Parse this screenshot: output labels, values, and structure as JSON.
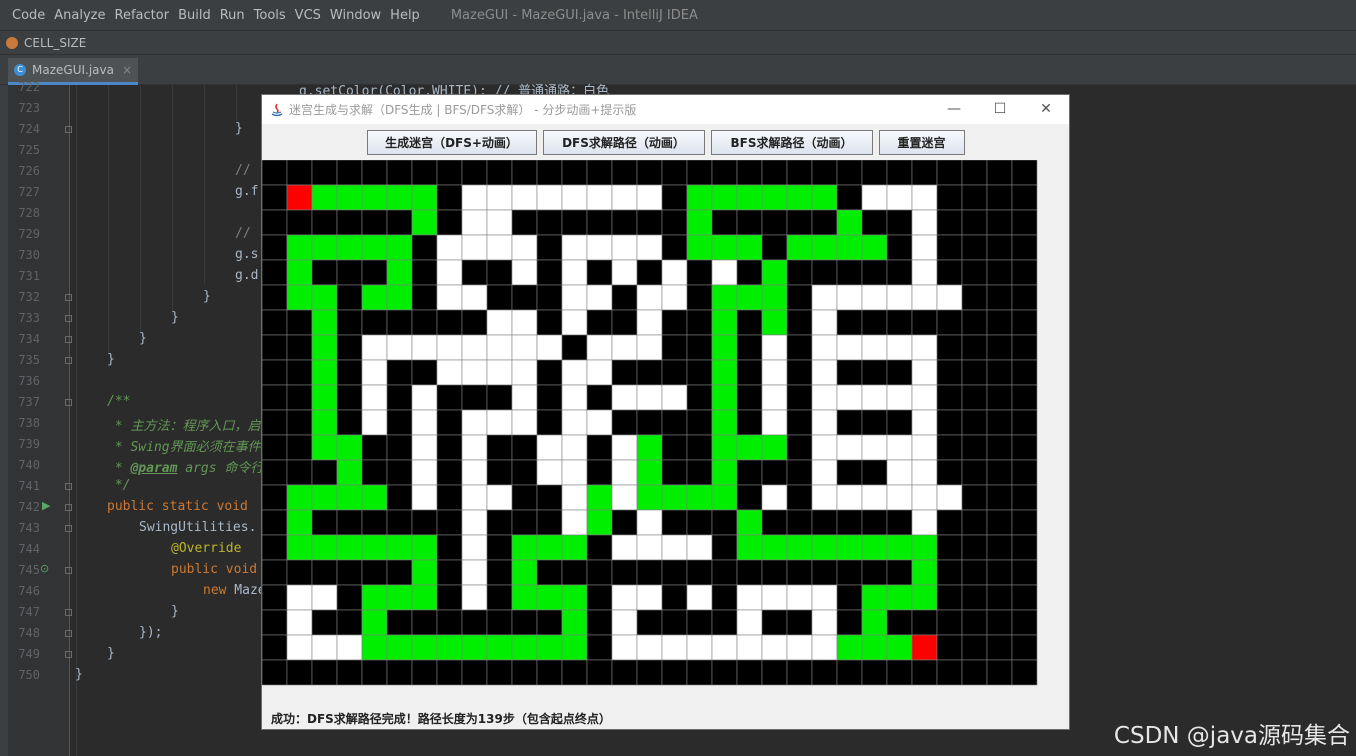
{
  "ide": {
    "menu": [
      "Code",
      "Analyze",
      "Refactor",
      "Build",
      "Run",
      "Tools",
      "VCS",
      "Window",
      "Help"
    ],
    "title": "MazeGUI - MazeGUI.java - IntelliJ IDEA",
    "breadcrumb": "CELL_SIZE",
    "tab": {
      "label": "MazeGUI.java",
      "close": "×"
    },
    "line_numbers": [
      "722",
      "723",
      "724",
      "725",
      "726",
      "727",
      "728",
      "729",
      "730",
      "731",
      "732",
      "733",
      "734",
      "735",
      "736",
      "737",
      "738",
      "739",
      "740",
      "741",
      "742",
      "743",
      "744",
      "745",
      "746",
      "747",
      "748",
      "749",
      "750"
    ],
    "code": {
      "l722": "g.setColor(Color.WHITE); // 普通通路：白色",
      "l724": "}",
      "l726": "// ",
      "l727": "g.f",
      "l729": "// ",
      "l730": "g.s",
      "l731": "g.d",
      "l732": "}",
      "l733": "}",
      "l734": "}",
      "l735": "}",
      "l737": "/**",
      "l738": " * 主方法：程序入口，启",
      "l739": " * Swing界面必须在事件",
      "l740_tag": "@param",
      "l740_rest": " args 命令行",
      "l740_star": " * ",
      "l741": " */",
      "l742_kw": "public static void",
      "l743": "SwingUtilities.",
      "l744": "@Override",
      "l745_kw": "public void",
      "l746_kw": "new",
      "l746_rest": " Maze",
      "l748": "});",
      "l749": "}",
      "l750": "}"
    },
    "watermark": "CSDN @java源码集合"
  },
  "window": {
    "title": "迷宫生成与求解（DFS生成 | BFS/DFS求解） - 分步动画+提示版",
    "controls": {
      "minimize": "—",
      "maximize": "☐",
      "close": "✕"
    },
    "buttons": [
      "生成迷宫（DFS+动画）",
      "DFS求解路径（动画）",
      "BFS求解路径（动画）",
      "重置迷宫"
    ],
    "status": "成功：DFS求解路径完成！路径长度为139步（包含起点终点）"
  },
  "maze": {
    "legend": {
      "0": "wall",
      "1": "passage",
      "2": "path",
      "3": "endpoint"
    },
    "colors": {
      "wall": "#000000",
      "passage": "#ffffff",
      "path": "#00ee00",
      "endpoint": "#ff0000",
      "grid": "#808080"
    },
    "rows": [
      "0000000000000000000000000000000",
      "0322222011111111022222201110",
      "0000002011000000020000020010",
      "0222220111101111022202222010",
      "0200020100101010101020000010",
      "0220220110001101102220111111",
      "0020000001101001002020100000",
      "0020111111110111002010111110",
      "0020100111101100002010100010",
      "0020101000101011102010111110",
      "0020101011101100002010100010",
      "0022001010011012002220111110",
      "0002001010011012002000100110",
      "0222201011001212222010111111",
      "0200000010001201000200000010",
      "0222222010222011110222222220",
      "0000002010200000000000000020",
      "0110222010222011010111102220",
      "0100200000002010000100102000",
      "0111222222222011111111122230",
      "0000000000000000000000000000"
    ]
  }
}
